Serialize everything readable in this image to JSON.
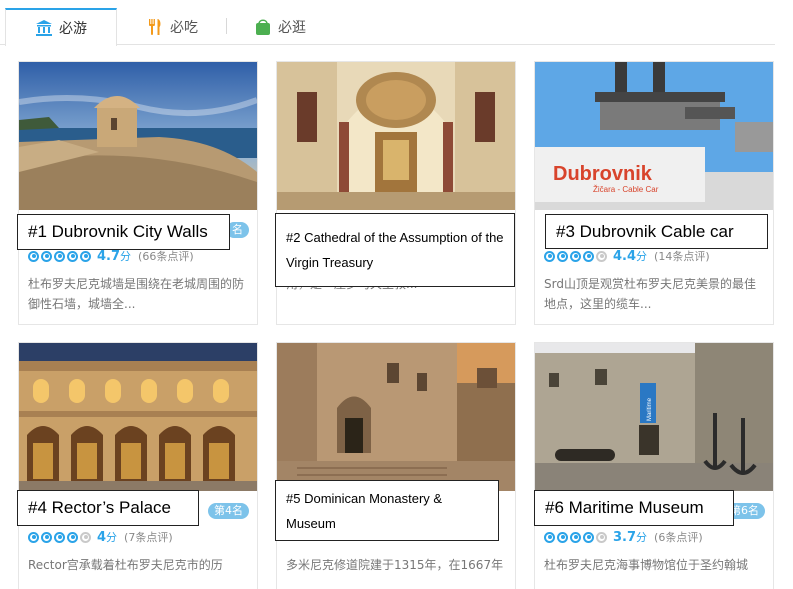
{
  "tabs": [
    {
      "label": "必游",
      "icon": "landmark-icon",
      "color": "#2aa3e8",
      "active": true
    },
    {
      "label": "必吃",
      "icon": "fork-knife-icon",
      "color": "#f39a1b",
      "active": false
    },
    {
      "label": "必逛",
      "icon": "shopping-bag-icon",
      "color": "#4caf50",
      "active": false
    }
  ],
  "cards": [
    {
      "title_label": "#1 Dubrovnik City Walls",
      "rank_badge": "名",
      "score": "4.7",
      "score_unit": "分",
      "reviews": "(66条点评)",
      "rating_filled": 5,
      "desc": "杜布罗夫尼克城墙是围绕在老城周围的防御性石墙，城墙全..."
    },
    {
      "title_label": "#2 Cathedral of the Assumption of the Virgin Treasury",
      "rank_badge": "",
      "score": "",
      "score_unit": "",
      "reviews": "",
      "rating_filled": 0,
      "desc": "角，是一座罗马天主教..."
    },
    {
      "title_label": "#3 Dubrovnik Cable car",
      "rank_badge": "",
      "score": "4.4",
      "score_unit": "分",
      "reviews": "(14条点评)",
      "rating_filled": 4,
      "desc": "Srd山顶是观赏杜布罗夫尼克美景的最佳地点，这里的缆车..."
    },
    {
      "title_label": "#4 Rector’s Palace",
      "rank_badge": "第4名",
      "score": "4",
      "score_unit": "分",
      "reviews": "(7条点评)",
      "rating_filled": 4,
      "desc": "Rector宫承载着杜布罗夫尼克市的历"
    },
    {
      "title_label": "#5 Dominican Monastery & Museum",
      "rank_badge": "",
      "score": "",
      "score_unit": "",
      "reviews": "",
      "rating_filled": 0,
      "desc": "多米尼克修道院建于1315年，在1667年"
    },
    {
      "title_label": "#6 Maritime Museum",
      "rank_badge": "第6名",
      "score": "3.7",
      "score_unit": "分",
      "reviews": "(6条点评)",
      "rating_filled": 4,
      "desc": "杜布罗夫尼克海事博物馆位于圣约翰城"
    }
  ],
  "photo_texts": {
    "cable_car_sign_line1": "Dubrovnik",
    "cable_car_sign_line2": "Žičara - Cable Car",
    "maritime_banner": "Maritime"
  }
}
